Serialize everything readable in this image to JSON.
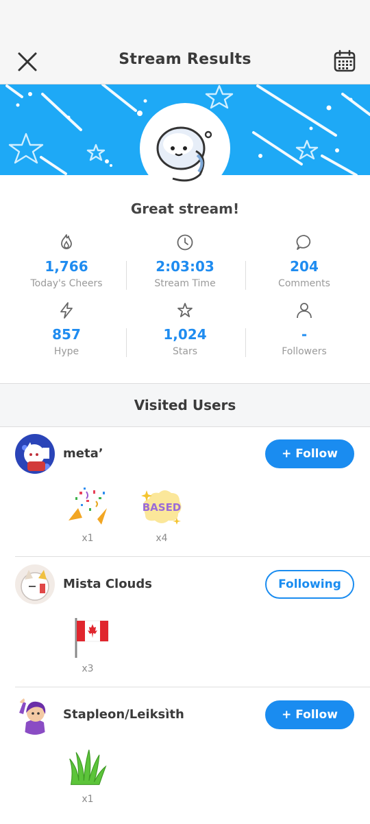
{
  "header": {
    "title": "Stream Results",
    "close_icon": "close-icon",
    "calendar_icon": "calendar-icon"
  },
  "banner": {
    "color": "#1ea9f6"
  },
  "summary": {
    "message": "Great stream!"
  },
  "stats": [
    {
      "icon": "flame-icon",
      "value": "1,766",
      "label": "Today's Cheers"
    },
    {
      "icon": "clock-icon",
      "value": "2:03:03",
      "label": "Stream Time"
    },
    {
      "icon": "comment-icon",
      "value": "204",
      "label": "Comments"
    },
    {
      "icon": "lightning-icon",
      "value": "857",
      "label": "Hype"
    },
    {
      "icon": "star-icon",
      "value": "1,024",
      "label": "Stars"
    },
    {
      "icon": "person-icon",
      "value": "-",
      "label": "Followers"
    }
  ],
  "visited": {
    "title": "Visited Users",
    "users": [
      {
        "name": "meta’",
        "button": "+ Follow",
        "following": false,
        "gifts": [
          {
            "icon": "party-popper-icon",
            "count": "x1"
          },
          {
            "icon": "based-sticker-icon",
            "count": "x4"
          }
        ]
      },
      {
        "name": "Mista Clouds",
        "button": "Following",
        "following": true,
        "gifts": [
          {
            "icon": "canada-flag-icon",
            "count": "x3"
          }
        ]
      },
      {
        "name": "Stapleon/Leiksìth",
        "button": "+ Follow",
        "following": false,
        "gifts": [
          {
            "icon": "grass-icon",
            "count": "x1"
          }
        ]
      }
    ]
  },
  "colors": {
    "accent": "#1a8cf0",
    "value_blue": "#1f8cf0",
    "banner": "#1ea9f6"
  }
}
